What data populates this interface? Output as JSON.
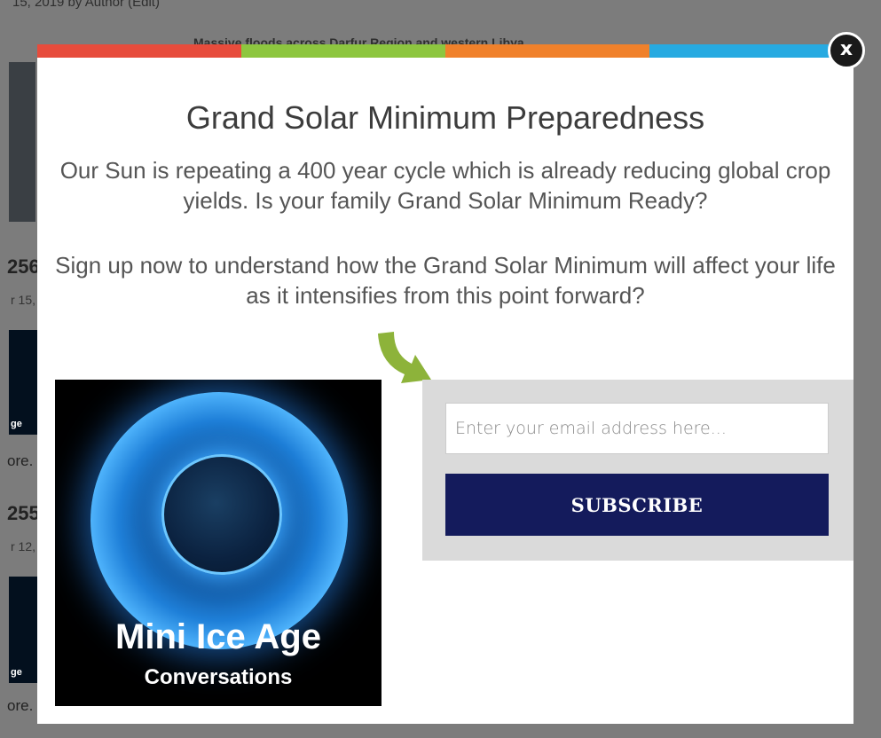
{
  "background": {
    "topline": "15, 2019 by Author (Edit)",
    "headline": "Massive floods across Darfur Region and western Libya",
    "items": [
      {
        "number": "256",
        "date": "r 15,",
        "more": "ore."
      },
      {
        "number": "255",
        "date": "r 12,",
        "more": "ore."
      }
    ],
    "thumb_caption": "ge"
  },
  "modal": {
    "title": "Grand Solar Minimum Preparedness",
    "paragraph1": "Our Sun is repeating a 400 year cycle which is already reducing global crop yields. Is your family Grand Solar Minimum Ready?",
    "paragraph2": "Sign up now to understand how the Grand Solar Minimum will affect your life as it intensifies from this point forward?",
    "image": {
      "title": "Mini Ice Age",
      "subtitle": "Conversations"
    },
    "form": {
      "email_placeholder": "Enter your email address here...",
      "email_value": "",
      "subscribe_label": "SUBSCRIBE"
    },
    "close_label": "x",
    "stripe_colors": [
      "#e74c3c",
      "#8dc63f",
      "#f0812b",
      "#27aae1"
    ],
    "arrow_color": "#8db33a",
    "button_color": "#141b5c"
  }
}
